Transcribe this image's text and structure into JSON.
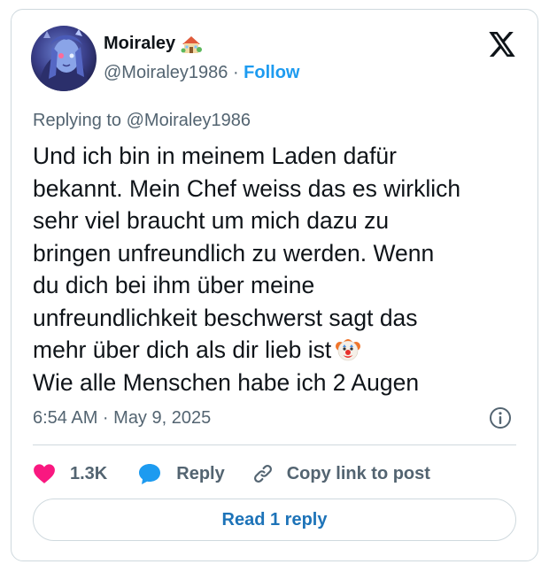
{
  "author": {
    "display_name": "Moiraley",
    "name_emoji": "house-with-garden-icon",
    "handle": "@Moiraley1986",
    "separator": "·",
    "follow_label": "Follow"
  },
  "reply_context": "Replying to @Moiraley1986",
  "tweet": {
    "lines": [
      "Und ich bin in meinem Laden dafür",
      "bekannt. Mein Chef weiss das es wirklich",
      "sehr viel braucht um mich dazu zu",
      "bringen unfreundlich zu werden. Wenn",
      "du dich bei ihm über meine",
      "unfreundlichkeit beschwerst sagt das",
      "mehr über dich als dir lieb ist",
      "Wie alle Menschen habe ich 2 Augen"
    ],
    "inline_emoji": "clown-face-icon"
  },
  "timestamp": "6:54 AM · May 9, 2025",
  "actions": {
    "like_count": "1.3K",
    "reply_label": "Reply",
    "copy_label": "Copy link to post"
  },
  "read_reply_label": "Read 1 reply",
  "colors": {
    "accent": "#1d9bf0",
    "like": "#f91880",
    "text_primary": "#0f1419",
    "text_secondary": "#536471",
    "border": "#cfd9de"
  }
}
